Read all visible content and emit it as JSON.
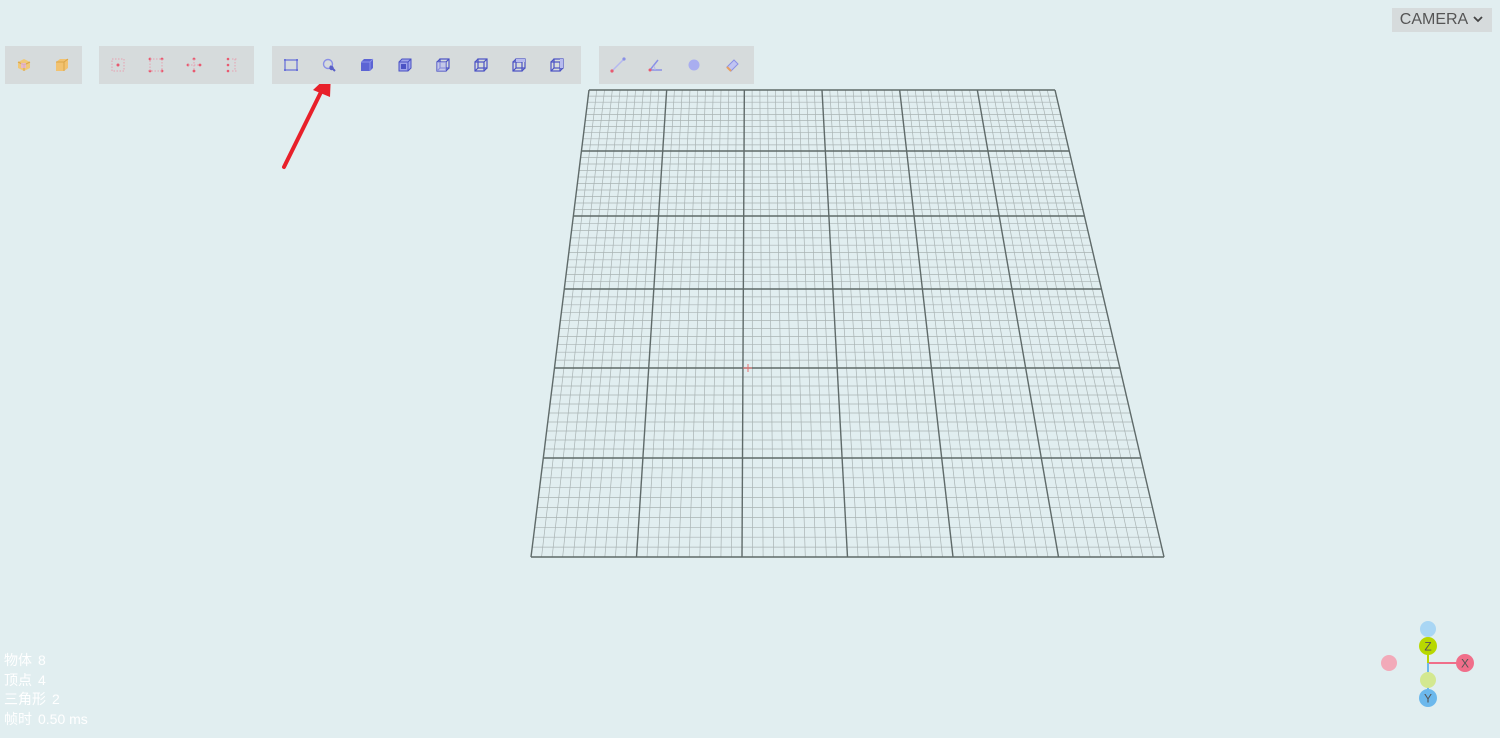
{
  "camera": {
    "label": "CAMERA",
    "icon": "chevron-down-icon"
  },
  "toolbar": {
    "groups": [
      {
        "name": "object-ops",
        "tools": [
          "box-object-icon",
          "solid-object-icon"
        ]
      },
      {
        "name": "selection-modes",
        "tools": [
          "select-center-icon",
          "select-vertices-icon",
          "select-move-icon",
          "select-column-icon"
        ]
      },
      {
        "name": "render-modes",
        "tools": [
          "rect-frame-icon",
          "paint-select-icon",
          "solid-cube-icon",
          "shaded-cube-icon",
          "wire-cube-front-icon",
          "wire-cube-back-icon",
          "wire-cube-left-icon",
          "wire-cube-right-icon"
        ]
      },
      {
        "name": "measure-tools",
        "tools": [
          "line-measure-icon",
          "angle-measure-icon",
          "point-icon",
          "eraser-icon"
        ]
      }
    ]
  },
  "stats": [
    {
      "label": "物体",
      "value": "8"
    },
    {
      "label": "顶点",
      "value": "4"
    },
    {
      "label": "三角形",
      "value": "2"
    },
    {
      "label": "帧时",
      "value": "0.50 ms"
    }
  ],
  "gizmo": {
    "labels": {
      "x": "X",
      "y": "Y",
      "z": "Z"
    },
    "colors": {
      "x": "#f06e8a",
      "y": "#6cb8ec",
      "z": "#b8d800"
    }
  },
  "annotation": {
    "color": "#e8202a"
  },
  "colors": {
    "background": "#e1eef0",
    "toolbar": "#d6dbdc",
    "grid_major": "#5f6a69",
    "grid_minor": "#a9b3b3"
  }
}
